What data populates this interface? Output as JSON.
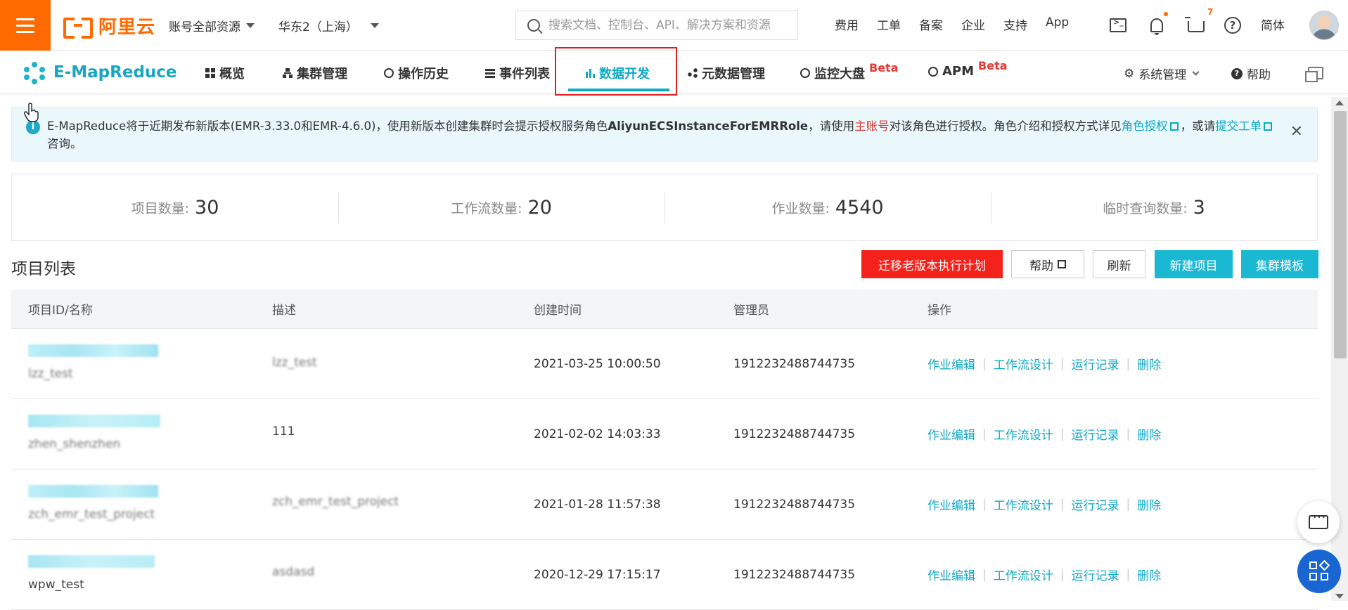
{
  "topbar": {
    "logo_text": "阿里云",
    "account_select": "账号全部资源",
    "region_select": "华东2（上海）",
    "search_placeholder": "搜索文档、控制台、API、解决方案和资源",
    "links": [
      "费用",
      "工单",
      "备案",
      "企业",
      "支持",
      "App"
    ],
    "cart_count": "7",
    "language": "简体"
  },
  "navbar": {
    "brand": "E-MapReduce",
    "items": [
      {
        "label": "概览",
        "icon": "grid-icon"
      },
      {
        "label": "集群管理",
        "icon": "cluster-icon"
      },
      {
        "label": "操作历史",
        "icon": "clock-icon"
      },
      {
        "label": "事件列表",
        "icon": "list-icon"
      },
      {
        "label": "数据开发",
        "icon": "bar-chart-icon",
        "active": true
      },
      {
        "label": "元数据管理",
        "icon": "share-icon"
      },
      {
        "label": "监控大盘",
        "icon": "monitor-icon",
        "badge": "Beta"
      },
      {
        "label": "APM",
        "icon": "apm-icon",
        "badge": "Beta"
      }
    ],
    "system_admin": "系统管理",
    "help": "帮助"
  },
  "notice": {
    "text_1": "E-MapReduce将于近期发布新版本(EMR-3.33.0和EMR-4.6.0)，使用新版本创建集群时会提示授权服务角色",
    "role_name": "AliyunECSInstanceForEMRRole",
    "text_2": "，请使用",
    "main_account": "主账号",
    "text_3": "对该角色进行授权。角色介绍和授权方式详见",
    "role_auth_link": "角色授权",
    "text_4": "，或请",
    "ticket_link": "提交工单",
    "text_5": "咨询。"
  },
  "stats": [
    {
      "label": "项目数量:",
      "value": "30"
    },
    {
      "label": "工作流数量:",
      "value": "20"
    },
    {
      "label": "作业数量:",
      "value": "4540"
    },
    {
      "label": "临时查询数量:",
      "value": "3"
    }
  ],
  "project_list": {
    "title": "项目列表",
    "buttons": {
      "migrate": "迁移老版本执行计划",
      "help": "帮助",
      "refresh": "刷新",
      "new_project": "新建项目",
      "cluster_template": "集群模板"
    },
    "columns": [
      "项目ID/名称",
      "描述",
      "创建时间",
      "管理员",
      "操作"
    ],
    "rows": [
      {
        "name": "lzz_test",
        "description": "lzz_test",
        "created": "2021-03-25 10:00:50",
        "admin": "1912232488744735"
      },
      {
        "name": "zhen_shenzhen",
        "description": "111",
        "created": "2021-02-02 14:03:33",
        "admin": "1912232488744735"
      },
      {
        "name": "zch_emr_test_project",
        "description": "zch_emr_test_project",
        "created": "2021-01-28 11:57:38",
        "admin": "1912232488744735"
      },
      {
        "name": "wpw_test",
        "description": "asdasd",
        "created": "2020-12-29 17:15:17",
        "admin": "1912232488744735"
      }
    ],
    "actions": [
      "作业编辑",
      "工作流设计",
      "运行记录",
      "删除"
    ]
  }
}
